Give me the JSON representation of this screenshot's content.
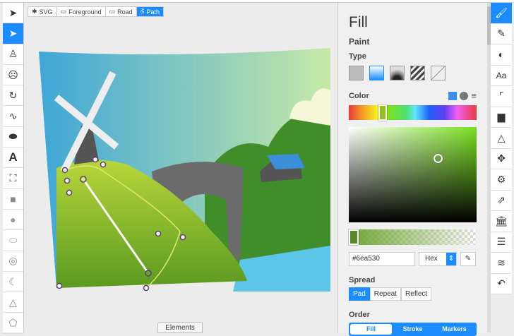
{
  "breadcrumb": [
    {
      "label": "SVG",
      "icon": "gear-icon"
    },
    {
      "label": "Foreground",
      "icon": "folder-icon"
    },
    {
      "label": "Road",
      "icon": "folder-icon"
    },
    {
      "label": "Path",
      "icon": "path-icon"
    }
  ],
  "left_tools": [
    "select",
    "direct-select",
    "person",
    "face",
    "rotate",
    "freehand",
    "ellipse-filled",
    "text",
    "frame",
    "rectangle",
    "circle",
    "ellipse",
    "ring",
    "pie",
    "triangle",
    "pentagon"
  ],
  "canvas": {
    "elements_label": "Elements"
  },
  "panel": {
    "title": "Fill",
    "paint": "Paint",
    "type_label": "Type",
    "color_label": "Color",
    "hex_value": "#6ea530",
    "format": "Hex",
    "spread_label": "Spread",
    "spread_options": [
      "Pad",
      "Repeat",
      "Reflect"
    ],
    "order_label": "Order",
    "order_options": [
      "Fill",
      "Stroke",
      "Markers"
    ]
  },
  "right_tools": [
    "fill",
    "stroke",
    "contrast",
    "typography",
    "ruler",
    "comment",
    "triangle",
    "move",
    "settings",
    "export",
    "library",
    "list",
    "layers",
    "undo"
  ],
  "colors": {
    "accent": "#1a8cff",
    "fill": "#6ea530"
  }
}
